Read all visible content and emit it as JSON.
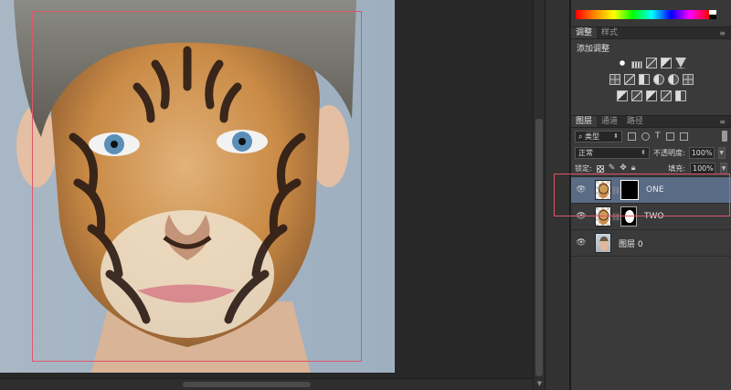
{
  "color_panel": {
    "spectrum_colors": [
      "#ff0000",
      "#ff8800",
      "#ffff00",
      "#00ff00",
      "#00ffff",
      "#0000ff",
      "#ff00ff"
    ]
  },
  "adjust_panel": {
    "tabs": [
      {
        "label": "调整"
      },
      {
        "label": "样式"
      }
    ],
    "title": "添加调整",
    "rows": [
      [
        "brightness-icon",
        "levels-icon",
        "curves-icon",
        "exposure-icon",
        "vibrance-icon"
      ],
      [
        "hue-saturation-icon",
        "color-balance-icon",
        "black-white-icon",
        "photo-filter-icon",
        "channel-mixer-icon",
        "color-lookup-icon"
      ],
      [
        "invert-icon",
        "posterize-icon",
        "threshold-icon",
        "gradient-map-icon",
        "selective-color-icon"
      ]
    ]
  },
  "layers_panel": {
    "tabs": [
      {
        "label": "图层"
      },
      {
        "label": "通道"
      },
      {
        "label": "路径"
      }
    ],
    "filter": {
      "value": "类型"
    },
    "blend_mode": {
      "value": "正常"
    },
    "opacity": {
      "label": "不透明度:",
      "value": "100%"
    },
    "lock": {
      "label": "锁定:"
    },
    "fill": {
      "label": "填充:",
      "value": "100%"
    },
    "layers": [
      {
        "name": "ONE",
        "selected": true,
        "mask": "black"
      },
      {
        "name": "TWO",
        "selected": false,
        "mask": "face"
      },
      {
        "name": "图层 0",
        "selected": false,
        "mask": "none"
      }
    ]
  },
  "accent": {
    "selection_color": "#e0566a",
    "selected_layer_bg": "#5a6b85"
  }
}
